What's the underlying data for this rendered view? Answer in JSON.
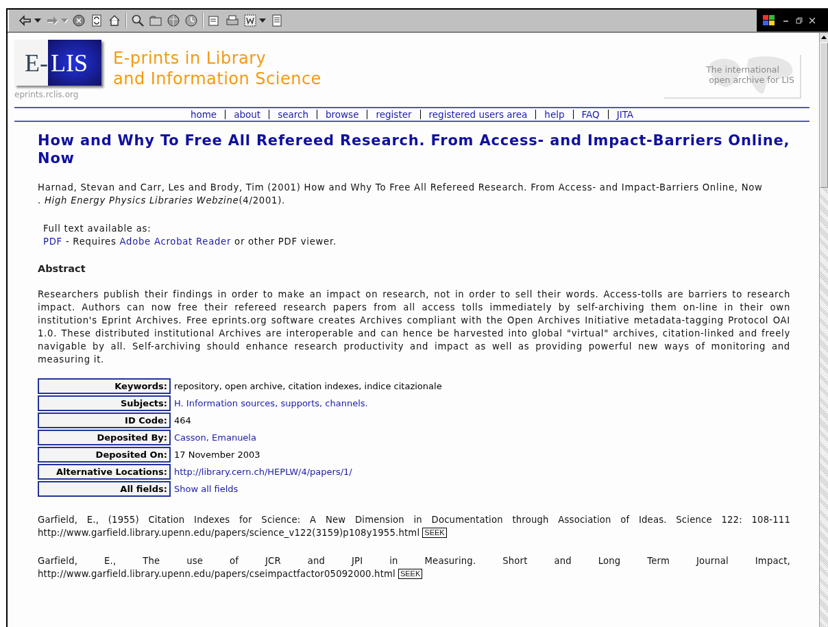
{
  "toolbar": [
    {
      "kind": "back",
      "disabled": false
    },
    {
      "kind": "dropdown",
      "disabled": false
    },
    {
      "kind": "forward",
      "disabled": true
    },
    {
      "kind": "dropdown",
      "disabled": true
    },
    {
      "kind": "stop",
      "disabled": false
    },
    {
      "kind": "refresh",
      "disabled": false
    },
    {
      "kind": "home",
      "disabled": false
    },
    {
      "kind": "sep"
    },
    {
      "kind": "search",
      "disabled": false
    },
    {
      "kind": "favorites",
      "disabled": false
    },
    {
      "kind": "media",
      "disabled": false
    },
    {
      "kind": "history",
      "disabled": false
    },
    {
      "kind": "sep"
    },
    {
      "kind": "mail",
      "disabled": false
    },
    {
      "kind": "print",
      "disabled": false
    },
    {
      "kind": "edit",
      "disabled": false
    },
    {
      "kind": "dropdown",
      "disabled": false
    },
    {
      "kind": "discuss",
      "disabled": false
    }
  ],
  "header": {
    "logo_left": "E-",
    "logo_right": "LIS",
    "logo_caption": "eprints.rclis.org",
    "title_lines": [
      "E-prints in Library",
      "and Information Science"
    ],
    "badge_lines": [
      "The international",
      "open archive for LIS"
    ]
  },
  "nav": [
    "home",
    "about",
    "search",
    "browse",
    "register",
    "registered users area",
    "help",
    "FAQ",
    "JITA"
  ],
  "title": "How and Why To Free All Refereed Research. From Access- and Impact-Barriers Online, Now",
  "citation": "Harnad, Stevan and Carr, Les and Brody, Tim (2001) How and Why To Free All Refereed Research. From Access- and Impact-Barriers Online, Now",
  "citation_source": ". *High Energy Physics Libraries Webzine*(4/2001).",
  "full_text": {
    "intro": "Full text available as:",
    "format_link": "PDF",
    "requires": "- Requires",
    "reader_link": "Adobe Acrobat Reader",
    "tail": "or other PDF viewer."
  },
  "abstract_heading": "Abstract",
  "abstract": "Researchers publish their findings in order to make an impact on research, not in order to sell their words. Access-tolls are barriers to research impact. Authors can now free their refereed research papers from all access tolls immediately by self-archiving them on-line in their own institution's Eprint Archives. Free eprints.org software creates Archives compliant with the Open Archives Initiative metadata-tagging Protocol OAI 1.0. These distributed institutional Archives are interoperable and can hence be harvested into global \"virtual\" archives, citation-linked and freely navigable by all. Self-archiving should enhance research productivity and impact as well as providing powerful new ways of monitoring and measuring it.",
  "fields": [
    {
      "label": "Keywords:",
      "value": "repository, open archive, citation indexes, indice citazionale",
      "kind": "text"
    },
    {
      "label": "Subjects:",
      "value": "H. Information sources, supports, channels.",
      "kind": "link"
    },
    {
      "label": "ID Code:",
      "value": "464",
      "kind": "text"
    },
    {
      "label": "Deposited By:",
      "value": "Casson, Emanuela",
      "kind": "link"
    },
    {
      "label": "Deposited On:",
      "value": "17 November 2003",
      "kind": "text"
    },
    {
      "label": "Alternative Locations:",
      "value": "http://library.cern.ch/HEPLW/4/papers/1/",
      "kind": "link"
    },
    {
      "label": "All fields:",
      "value": "Show all fields",
      "kind": "link"
    }
  ],
  "references": [
    {
      "text": "Garfield, E., (1955) Citation Indexes for Science: A New Dimension in Documentation through Association of Ideas. Science 122: 108-111",
      "url": "http://www.garfield.library.upenn.edu/papers/science_v122(3159)p108y1955.html",
      "badge": "SEEK"
    },
    {
      "text": "Garfield, E., The use of JCR and JPI in Measuring. Short and Long Term Journal Impact,",
      "url": "http://www.garfield.library.upenn.edu/papers/cseimpactfactor05092000.html",
      "badge": "SEEK"
    }
  ]
}
